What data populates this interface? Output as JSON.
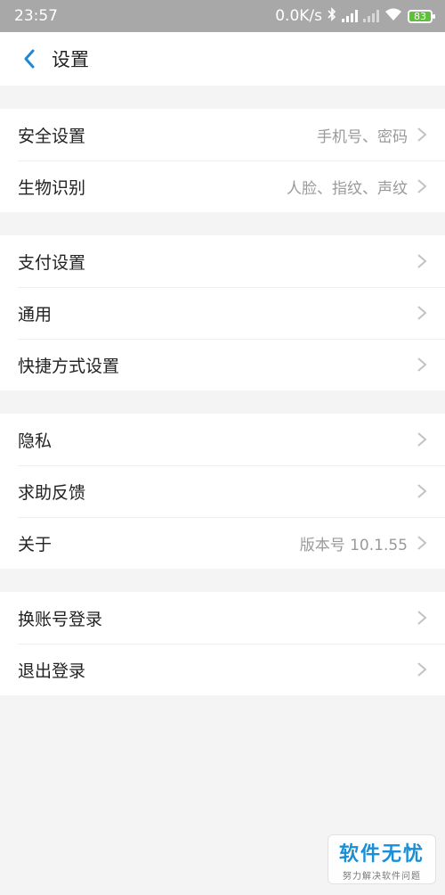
{
  "statusbar": {
    "time": "23:57",
    "net_speed": "0.0K/s",
    "battery": "83"
  },
  "header": {
    "title": "设置"
  },
  "groups": [
    {
      "items": [
        {
          "label": "安全设置",
          "value": "手机号、密码"
        },
        {
          "label": "生物识别",
          "value": "人脸、指纹、声纹"
        }
      ]
    },
    {
      "items": [
        {
          "label": "支付设置",
          "value": ""
        },
        {
          "label": "通用",
          "value": ""
        },
        {
          "label": "快捷方式设置",
          "value": ""
        }
      ]
    },
    {
      "items": [
        {
          "label": "隐私",
          "value": ""
        },
        {
          "label": "求助反馈",
          "value": ""
        },
        {
          "label": "关于",
          "value": "版本号 10.1.55"
        }
      ]
    },
    {
      "items": [
        {
          "label": "换账号登录",
          "value": ""
        },
        {
          "label": "退出登录",
          "value": ""
        }
      ]
    }
  ],
  "watermark": {
    "main": "软件无忧",
    "sub": "努力解决软件问题"
  }
}
